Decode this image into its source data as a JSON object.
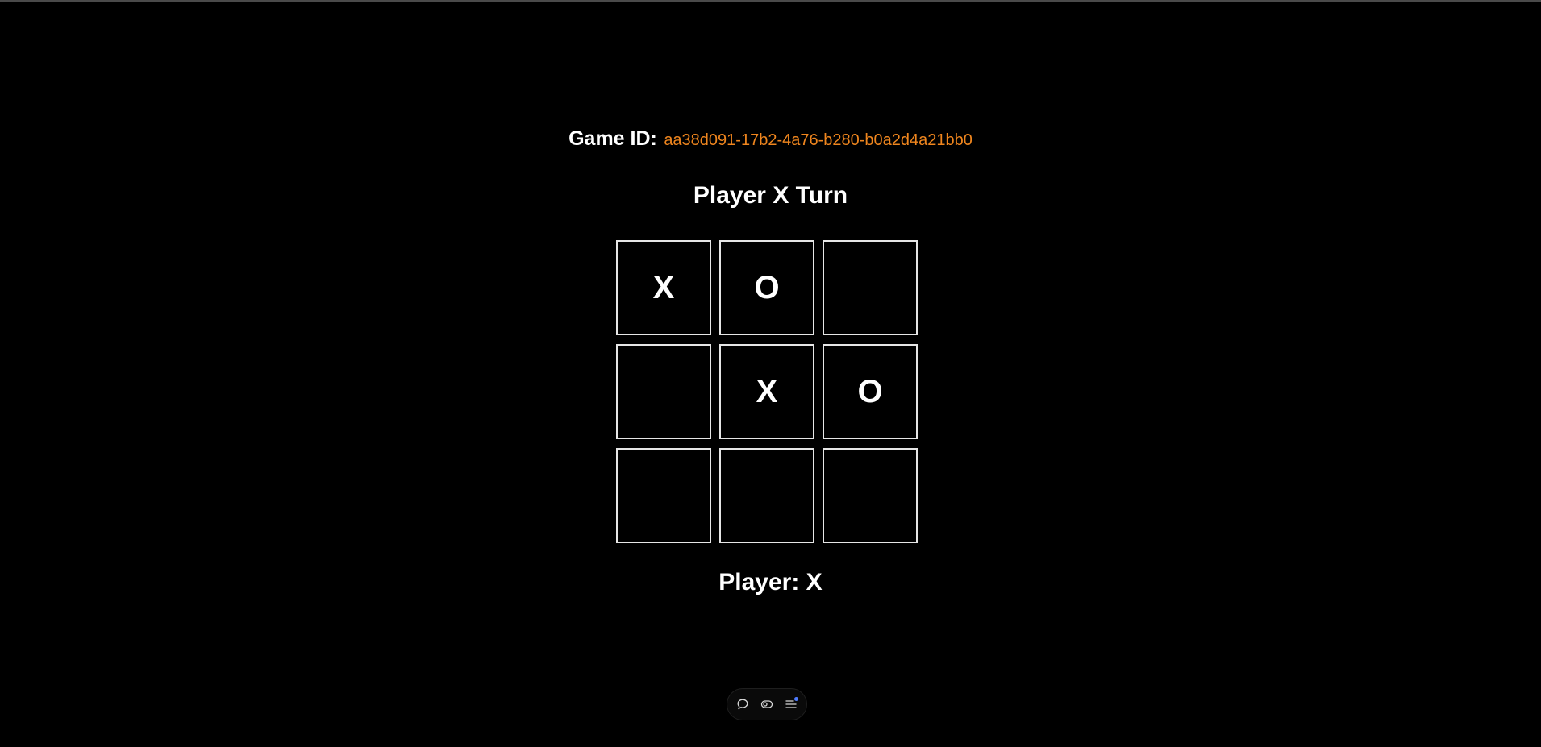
{
  "header": {
    "game_id_label": "Game ID:",
    "game_id_value": "aa38d091-17b2-4a76-b280-b0a2d4a21bb0"
  },
  "status": {
    "turn_text": "Player X Turn",
    "player_text": "Player: X"
  },
  "board": {
    "cells": [
      "X",
      "O",
      "",
      "",
      "X",
      "O",
      "",
      "",
      ""
    ]
  },
  "toolbar": {
    "icons": [
      "chat-icon",
      "toggle-icon",
      "menu-icon"
    ]
  },
  "colors": {
    "background": "#000000",
    "text": "#ffffff",
    "accent": "#f0861e",
    "cell_border": "#e6e6e6",
    "notification": "#4f7cff"
  }
}
